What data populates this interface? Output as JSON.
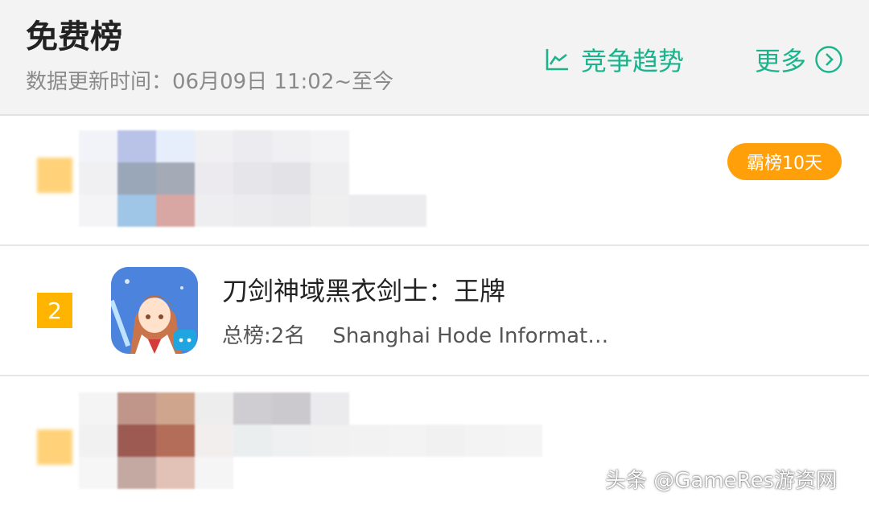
{
  "header": {
    "title": "免费榜",
    "update_time": "数据更新时间：06月09日 11:02~至今",
    "trend_label": "竞争趋势",
    "trend_icon": "line-chart-icon",
    "more_label": "更多",
    "more_icon": "chevron-right-circle-icon",
    "accent_color": "#1bb38c"
  },
  "rows": [
    {
      "rank": "",
      "badge": "霸榜10天",
      "blurred": true
    },
    {
      "rank": "2",
      "app_name": "刀剑神域黑衣剑士：王牌",
      "total_rank": "总榜:2名",
      "developer": "Shanghai Hode Informati…",
      "icon": "sword-art-online-app-icon"
    },
    {
      "rank": "",
      "blurred": true
    }
  ],
  "watermark": "头条 @GameRes游资网",
  "colors": {
    "rank_badge": "#ffb400",
    "streak_badge": "#ff9f0a",
    "header_bg": "#f3f3f3"
  }
}
